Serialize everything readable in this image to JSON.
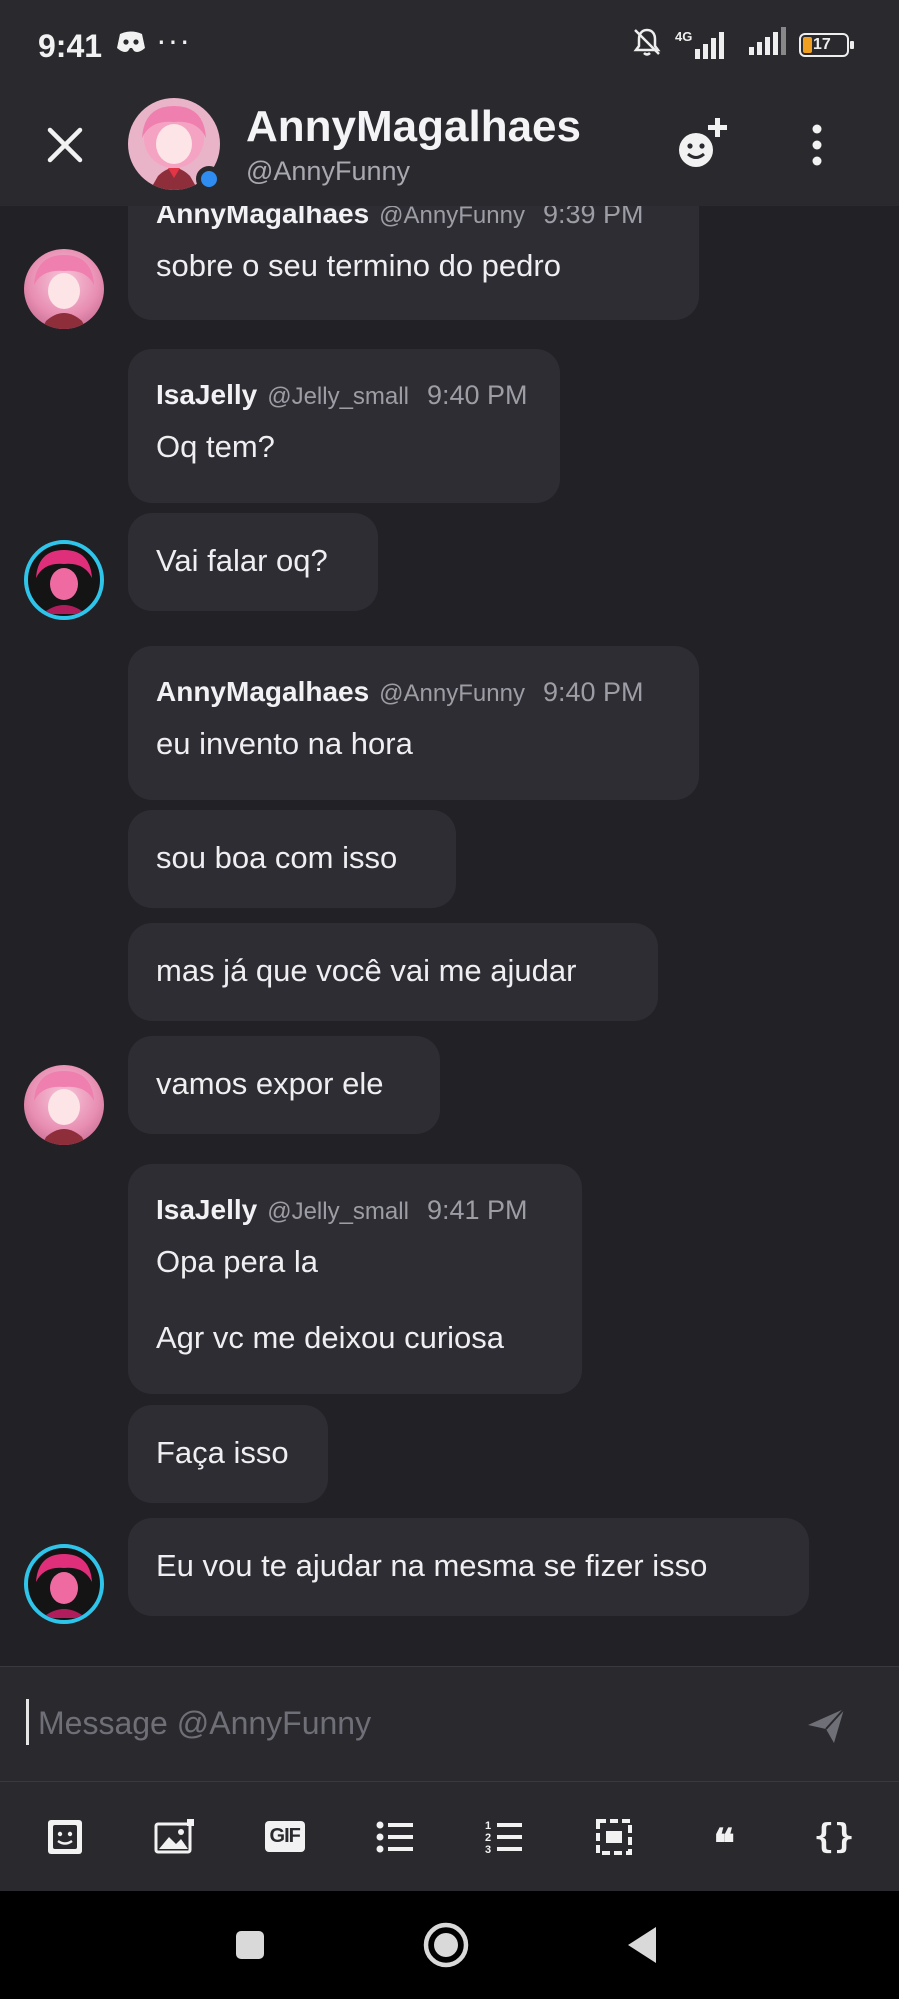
{
  "status_bar": {
    "time": "9:41",
    "more": "···",
    "network": "4G",
    "battery": "17"
  },
  "header": {
    "name": "AnnyMagalhaes",
    "handle": "@AnnyFunny",
    "presence_color": "#2f8cf0"
  },
  "messages": [
    {
      "author": "AnnyMagalhaes",
      "username": "@AnnyFunny",
      "time": "9:39 PM",
      "text": "sobre o seu termino do pedro"
    },
    {
      "author": "IsaJelly",
      "username": "@Jelly_small",
      "time": "9:40 PM",
      "text": "Oq tem?"
    },
    {
      "text": "Vai falar oq?"
    },
    {
      "author": "AnnyMagalhaes",
      "username": "@AnnyFunny",
      "time": "9:40 PM",
      "text": "eu invento na hora"
    },
    {
      "text": "sou boa com isso"
    },
    {
      "text": "mas já que você vai me ajudar"
    },
    {
      "text": "vamos expor ele"
    },
    {
      "author": "IsaJelly",
      "username": "@Jelly_small",
      "time": "9:41 PM",
      "text": "Opa pera la",
      "text2": "Agr vc me deixou curiosa"
    },
    {
      "text": "Faça isso"
    },
    {
      "text": "Eu vou te ajudar na mesma se fizer isso"
    }
  ],
  "composer": {
    "placeholder": "Message @AnnyFunny"
  },
  "toolbar": {
    "gif_label": "GIF",
    "quote_label": "❝",
    "code_label": "{}"
  },
  "colors": {
    "background": "#222126",
    "bubble": "#2e2d33",
    "bar": "#2a292e",
    "isa_ring": "#2fc4ea"
  }
}
